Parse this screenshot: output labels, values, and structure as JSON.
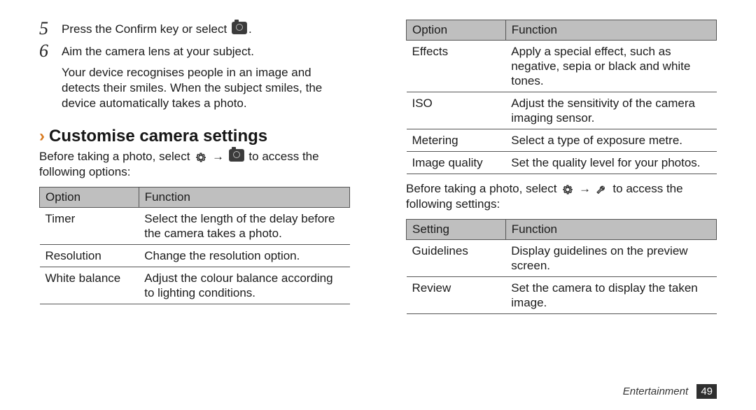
{
  "steps": {
    "s5": {
      "num": "5",
      "text_a": "Press the Confirm key or select",
      "text_b": "."
    },
    "s6": {
      "num": "6",
      "text": "Aim the camera lens at your subject.",
      "sub": "Your device recognises people in an image and detects their smiles. When the subject smiles, the device automatically takes a photo."
    }
  },
  "heading": "Customise camera settings",
  "intro1": {
    "a": "Before taking a photo, select",
    "b": "→",
    "c": "to access the following options:"
  },
  "table1": {
    "h1": "Option",
    "h2": "Function",
    "rows": [
      {
        "o": "Timer",
        "f": "Select the length of the delay before the camera takes a photo."
      },
      {
        "o": "Resolution",
        "f": "Change the resolution option."
      },
      {
        "o": "White balance",
        "f": "Adjust the colour balance according to lighting conditions."
      }
    ]
  },
  "table2": {
    "h1": "Option",
    "h2": "Function",
    "rows": [
      {
        "o": "Effects",
        "f": "Apply a special effect, such as negative, sepia or black and white tones."
      },
      {
        "o": "ISO",
        "f": "Adjust the sensitivity of the camera imaging sensor."
      },
      {
        "o": "Metering",
        "f": "Select a type of exposure metre."
      },
      {
        "o": "Image quality",
        "f": "Set the quality level for your photos."
      }
    ]
  },
  "intro2": {
    "a": "Before taking a photo, select",
    "b": "→",
    "c": "to access the following settings:"
  },
  "table3": {
    "h1": "Setting",
    "h2": "Function",
    "rows": [
      {
        "o": "Guidelines",
        "f": "Display guidelines on the preview screen."
      },
      {
        "o": "Review",
        "f": "Set the camera to display the taken image."
      }
    ]
  },
  "footer": {
    "section": "Entertainment",
    "page": "49"
  }
}
